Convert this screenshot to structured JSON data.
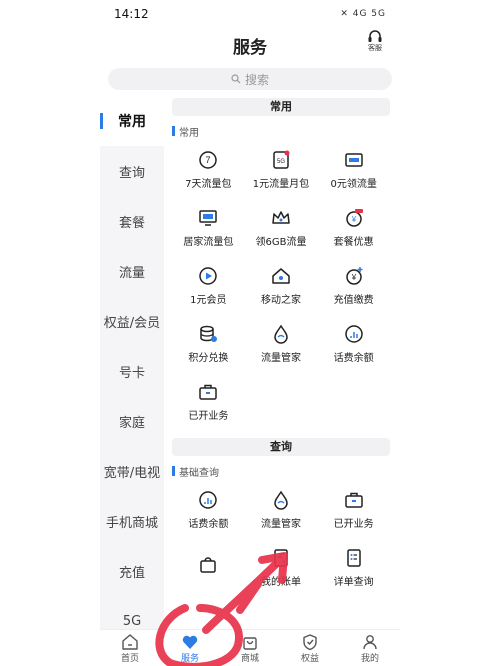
{
  "status": {
    "time": "14:12",
    "icons": "✕ 4G 5G"
  },
  "header": {
    "title": "服务",
    "cs_label": "客服"
  },
  "search": {
    "placeholder": "搜索"
  },
  "sidebar": {
    "items": [
      {
        "label": "常用",
        "active": true
      },
      {
        "label": "查询"
      },
      {
        "label": "套餐"
      },
      {
        "label": "流量"
      },
      {
        "label": "权益/会员"
      },
      {
        "label": "号卡"
      },
      {
        "label": "家庭"
      },
      {
        "label": "宽带/电视"
      },
      {
        "label": "手机商城"
      },
      {
        "label": "充值"
      },
      {
        "label": "5G"
      }
    ]
  },
  "section1": {
    "header": "常用",
    "title": "常用",
    "items": [
      {
        "label": "7天流量包",
        "icon": "7day-icon"
      },
      {
        "label": "1元流量月包",
        "icon": "5g-package-icon"
      },
      {
        "label": "0元领流量",
        "icon": "data-card-icon"
      },
      {
        "label": "居家流量包",
        "icon": "home-data-icon"
      },
      {
        "label": "领6GB流量",
        "icon": "crown-icon"
      },
      {
        "label": "套餐优惠",
        "icon": "discount-icon"
      },
      {
        "label": "1元会员",
        "icon": "play-icon"
      },
      {
        "label": "移动之家",
        "icon": "house-icon"
      },
      {
        "label": "充值缴费",
        "icon": "yuan-plus-icon"
      },
      {
        "label": "积分兑换",
        "icon": "points-icon"
      },
      {
        "label": "流量管家",
        "icon": "drop-icon"
      },
      {
        "label": "话费余额",
        "icon": "balance-icon"
      },
      {
        "label": "已开业务",
        "icon": "briefcase-icon"
      }
    ]
  },
  "section2": {
    "header": "查询",
    "title": "基础查询",
    "items": [
      {
        "label": "话费余额",
        "icon": "balance-icon"
      },
      {
        "label": "流量管家",
        "icon": "drop-icon"
      },
      {
        "label": "已开业务",
        "icon": "briefcase-icon"
      },
      {
        "label": "",
        "icon": "bag-icon"
      },
      {
        "label": "我的账单",
        "icon": "bill-icon"
      },
      {
        "label": "详单查询",
        "icon": "detail-list-icon"
      }
    ]
  },
  "tabbar": {
    "items": [
      {
        "label": "首页",
        "icon": "home-tab-icon"
      },
      {
        "label": "服务",
        "icon": "heart-tab-icon",
        "active": true
      },
      {
        "label": "商城",
        "icon": "shop-tab-icon"
      },
      {
        "label": "权益",
        "icon": "shield-tab-icon"
      },
      {
        "label": "我的",
        "icon": "user-tab-icon"
      }
    ]
  },
  "colors": {
    "accent": "#2d7be5",
    "annotation": "#e8324a",
    "sidebar_bg": "#f5f5f7"
  }
}
